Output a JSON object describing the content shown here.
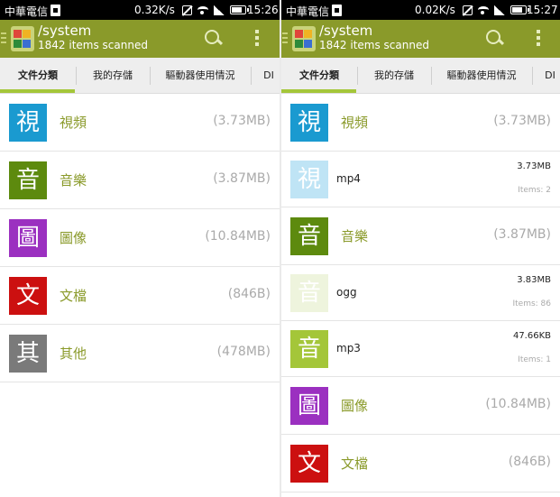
{
  "left": {
    "status": {
      "carrier": "中華電信",
      "speed": "0.32K/s",
      "time": "15:26"
    },
    "actionbar": {
      "title": "/system",
      "subtitle": "1842 items scanned"
    },
    "tabs": [
      "文件分類",
      "我的存儲",
      "驅動器使用情況",
      "DI"
    ],
    "rows": [
      {
        "type": "category",
        "glyph": "視",
        "label": "視頻",
        "size": "(3.73MB)",
        "color": "#1a9ad0"
      },
      {
        "type": "category",
        "glyph": "音",
        "label": "音樂",
        "size": "(3.87MB)",
        "color": "#5d8a0e"
      },
      {
        "type": "category",
        "glyph": "圖",
        "label": "圖像",
        "size": "(10.84MB)",
        "color": "#9b30c0"
      },
      {
        "type": "category",
        "glyph": "文",
        "label": "文檔",
        "size": "(846B)",
        "color": "#cc1010"
      },
      {
        "type": "category",
        "glyph": "其",
        "label": "其他",
        "size": "(478MB)",
        "color": "#7a7a7a"
      }
    ]
  },
  "right": {
    "status": {
      "carrier": "中華電信",
      "speed": "0.02K/s",
      "time": "15:27"
    },
    "actionbar": {
      "title": "/system",
      "subtitle": "1842 items scanned"
    },
    "tabs": [
      "文件分類",
      "我的存儲",
      "驅動器使用情況",
      "DI"
    ],
    "rows": [
      {
        "type": "category",
        "glyph": "視",
        "label": "視頻",
        "size": "(3.73MB)",
        "color": "#1a9ad0"
      },
      {
        "type": "sub",
        "glyph": "視",
        "label": "mp4",
        "size": "3.73MB",
        "items": "Items: 2",
        "color": "#bfe4f5"
      },
      {
        "type": "category",
        "glyph": "音",
        "label": "音樂",
        "size": "(3.87MB)",
        "color": "#5d8a0e"
      },
      {
        "type": "sub",
        "glyph": "音",
        "label": "ogg",
        "size": "3.83MB",
        "items": "Items: 86",
        "color": "#eef4dd"
      },
      {
        "type": "sub",
        "glyph": "音",
        "label": "mp3",
        "size": "47.66KB",
        "items": "Items: 1",
        "color": "#a4c639"
      },
      {
        "type": "category",
        "glyph": "圖",
        "label": "圖像",
        "size": "(10.84MB)",
        "color": "#9b30c0"
      },
      {
        "type": "category",
        "glyph": "文",
        "label": "文檔",
        "size": "(846B)",
        "color": "#cc1010"
      }
    ]
  },
  "icons": {
    "sim": "sim-card-icon",
    "mute": "mute-icon",
    "wifi": "wifi-icon",
    "signal": "signal-icon",
    "battery": "battery-icon",
    "menu": "drawer-menu-icon",
    "logo": "app-logo-icon",
    "search": "search-icon",
    "overflow": "overflow-menu-icon"
  },
  "accent": "#a4c639",
  "actionbar_color": "#8a9a2a"
}
